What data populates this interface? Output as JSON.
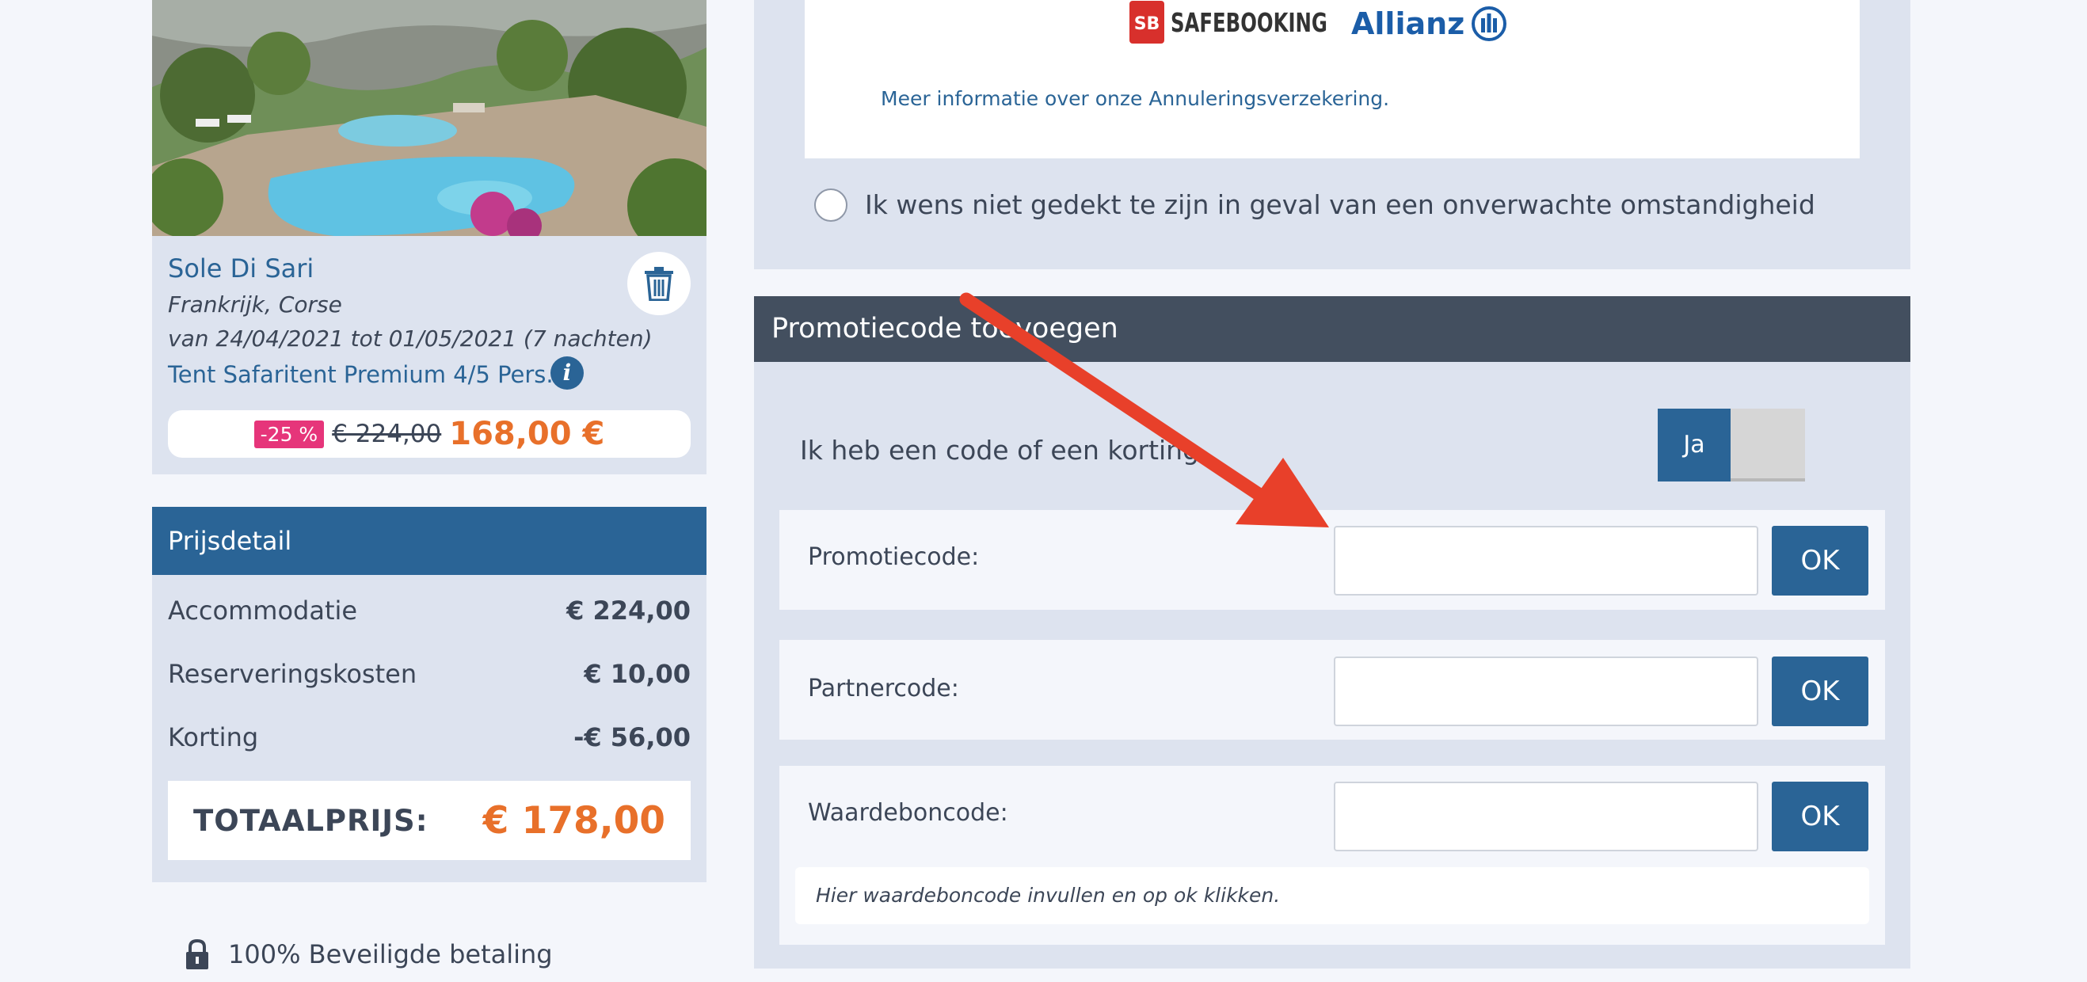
{
  "stay": {
    "name": "Sole Di Sari",
    "location": "Frankrijk, Corse",
    "dates": "van 24/04/2021 tot 01/05/2021 (7 nachten)",
    "unit": "Tent Safaritent Premium 4/5 Pers.",
    "discount_badge": "-25 %",
    "old_price": "€ 224,00",
    "new_price": "168,00 €",
    "photo_icon": "campsite-pool-photo",
    "trash_icon": "trash-icon",
    "info_icon": "info-icon"
  },
  "price_detail": {
    "title": "Prijsdetail",
    "rows": [
      {
        "label": "Accommodatie",
        "amount": "€ 224,00"
      },
      {
        "label": "Reserveringskosten",
        "amount": "€ 10,00"
      },
      {
        "label": "Korting",
        "amount": "-€ 56,00"
      }
    ],
    "total_label": "TOTAALPRIJS:",
    "total_amount": "€ 178,00"
  },
  "secure_payment": "100% Beveiligde betaling",
  "insurance": {
    "safebooking_badge": "SB",
    "safebooking_text": "SAFEBOOKING",
    "allianz_text": "Allianz",
    "more_info_link": "Meer informatie over onze Annuleringsverzekering.",
    "decline_label": "Ik wens niet gedekt te zijn in geval van een onverwachte omstandigheid"
  },
  "promo": {
    "title": "Promotiecode toevoegen",
    "toggle_label": "Ik heb een code of een korting",
    "toggle_on": "Ja",
    "fields": [
      {
        "label": "Promotiecode:",
        "value": "",
        "button": "OK"
      },
      {
        "label": "Partnercode:",
        "value": "",
        "button": "OK"
      },
      {
        "label": "Waardeboncode:",
        "value": "",
        "button": "OK"
      }
    ],
    "hint": "Hier waardeboncode invullen en op ok klikken."
  },
  "colors": {
    "brand_blue": "#2a6496",
    "accent_orange": "#e8702a",
    "discount_pink": "#e6357a",
    "annotation_arrow": "#e8402a"
  }
}
